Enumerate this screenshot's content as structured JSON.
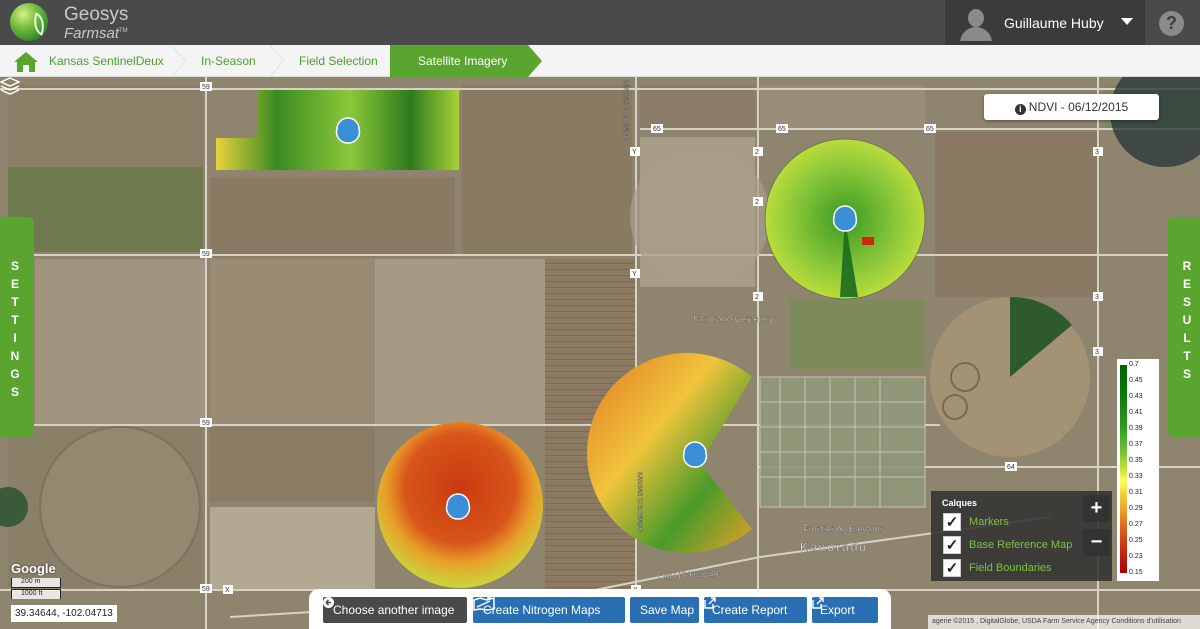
{
  "header": {
    "brand": "Geosys",
    "product": "Farmsat",
    "product_tm": "TM",
    "user_name": "Guillaume Huby",
    "help_label": "?"
  },
  "breadcrumb": {
    "items": [
      "Kansas SentinelDeux",
      "In-Season",
      "Field Selection",
      "Satellite Imagery"
    ]
  },
  "side_tabs": {
    "left": "SETTINGS",
    "right": "RESULTS"
  },
  "ndvi": {
    "label": "NDVI - 06/12/2015"
  },
  "legend": {
    "values": [
      "0.7",
      "0.45",
      "0.43",
      "0.41",
      "0.39",
      "0.37",
      "0.35",
      "0.33",
      "0.31",
      "0.29",
      "0.27",
      "0.25",
      "0.23",
      "0.15"
    ]
  },
  "calques": {
    "title": "Calques",
    "items": [
      {
        "label": "Markers",
        "checked": true
      },
      {
        "label": "Base Reference Map",
        "checked": true
      },
      {
        "label": "Field Boundaries",
        "checked": true
      }
    ]
  },
  "zoom": {
    "in": "+",
    "out": "−"
  },
  "map_labels": {
    "cemetery": "Kanorado Cemetery",
    "elevator": "Frontier Ag Elevator",
    "town": "Kanorado",
    "highway": "Old US Hwy 24",
    "road_left": "KANSAS COLORADO",
    "road_bottom": "KANSAS COLORADO",
    "routes": [
      "59",
      "59",
      "59",
      "59",
      "65",
      "65",
      "65",
      "Y",
      "Y",
      "2",
      "2",
      "2",
      "3",
      "3",
      "3",
      "64",
      "X",
      "X"
    ]
  },
  "map_footer": {
    "google": "Google",
    "scale_m": "200 m",
    "scale_ft": "1000 ft",
    "coords": "39.34644, -102.04713",
    "attribution": "agerie ©2015 , DigitalGlobe, USDA Farm Service Agency Conditions d'utilisation"
  },
  "toolbar": {
    "choose_image": "Choose another image",
    "nitrogen": "Create Nitrogen Maps",
    "save": "Save Map",
    "report": "Create Report",
    "export": "Export"
  },
  "colors": {
    "accent_green": "#5aa52f",
    "header_dark": "#4a4a4a",
    "button_blue": "#2b6fb3"
  }
}
